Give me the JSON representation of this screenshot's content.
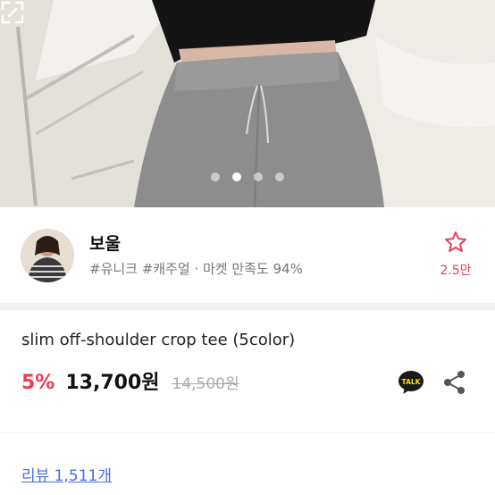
{
  "gallery": {
    "image_alt": "",
    "slide_count": 4,
    "active_index": 1,
    "expand_icon": "expand-icon"
  },
  "shop": {
    "name": "보울",
    "meta": "#유니크 #캐주얼 · 마켓 만족도 94%",
    "favorite_icon": "star-outline-icon",
    "favorite_count": "2.5만"
  },
  "product": {
    "title": "slim off-shoulder crop tee (5color)",
    "discount": "5%",
    "price": "13,700원",
    "original_price": "14,500원"
  },
  "actions": {
    "talk_label": "TALK",
    "talk_icon": "kakao-talk-icon",
    "share_icon": "share-icon"
  },
  "reviews": {
    "label": "리뷰 1,511개"
  },
  "colors": {
    "accent_red": "#ee3b53",
    "star_pink": "#e0445c",
    "link_blue": "#4a6ee0"
  }
}
